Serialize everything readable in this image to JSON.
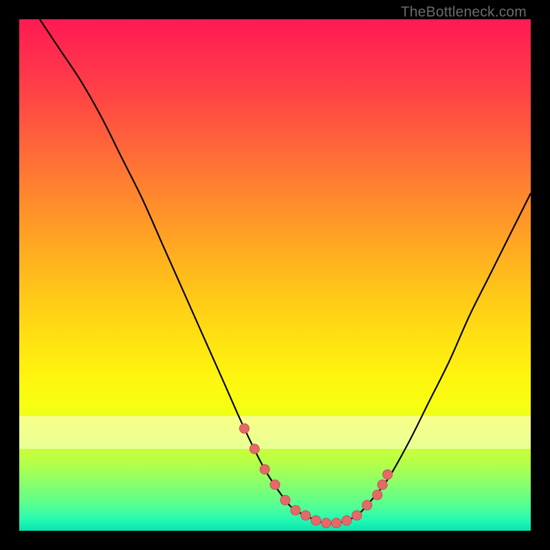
{
  "watermark": {
    "text": "TheBottleneck.com"
  },
  "colors": {
    "page_bg": "#000000",
    "curve_stroke": "#000000",
    "marker_fill": "#e46a6a",
    "marker_stroke": "#c94f4f"
  },
  "chart_data": {
    "type": "line",
    "title": "",
    "xlabel": "",
    "ylabel": "",
    "xlim": [
      0,
      100
    ],
    "ylim": [
      0,
      100
    ],
    "grid": false,
    "legend": false,
    "series": [
      {
        "name": "bottleneck-curve",
        "x": [
          4,
          8,
          12,
          16,
          20,
          24,
          28,
          32,
          36,
          40,
          44,
          48,
          52,
          54,
          56,
          58,
          60,
          62,
          64,
          66,
          68,
          72,
          76,
          80,
          84,
          88,
          92,
          96,
          100
        ],
        "y": [
          100,
          94,
          88,
          81,
          73,
          65,
          56,
          47,
          38,
          29,
          20,
          12,
          6,
          4,
          3,
          2,
          1.5,
          1.5,
          2,
          3,
          5,
          10,
          17,
          25,
          33,
          42,
          50,
          58,
          66
        ]
      }
    ],
    "markers": {
      "name": "highlight-points",
      "x": [
        44,
        46,
        48,
        50,
        52,
        54,
        56,
        58,
        60,
        62,
        64,
        66,
        68,
        70,
        71,
        72
      ],
      "y": [
        20,
        16,
        12,
        9,
        6,
        4,
        3,
        2,
        1.5,
        1.5,
        2,
        3,
        5,
        7,
        9,
        11
      ]
    }
  }
}
